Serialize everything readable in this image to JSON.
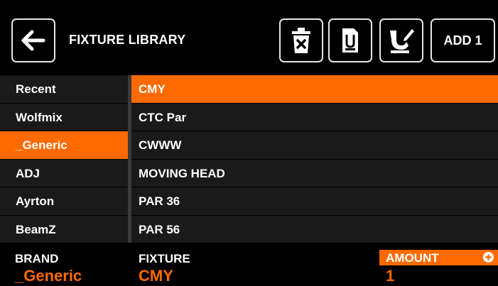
{
  "header": {
    "title": "FIXTURE LIBRARY",
    "add_label": "ADD 1",
    "icons": [
      "back-arrow-icon",
      "trash-icon",
      "save-icon",
      "edit-icon"
    ]
  },
  "brands": [
    {
      "label": "Recent"
    },
    {
      "label": "Wolfmix"
    },
    {
      "label": "_Generic"
    },
    {
      "label": "ADJ"
    },
    {
      "label": "Ayrton"
    },
    {
      "label": "BeamZ"
    }
  ],
  "fixtures": [
    {
      "label": "CMY"
    },
    {
      "label": "CTC Par"
    },
    {
      "label": "CWWW"
    },
    {
      "label": "MOVING HEAD"
    },
    {
      "label": "PAR 36"
    },
    {
      "label": "PAR 56"
    }
  ],
  "selected": {
    "brand_index": 2,
    "fixture_index": 0
  },
  "footer": {
    "brand_label": "BRAND",
    "brand_value": "_Generic",
    "fixture_label": "FIXTURE",
    "fixture_value": "CMY",
    "amount_label": "AMOUNT",
    "amount_value": "1"
  },
  "colors": {
    "accent": "#ff6a00",
    "row_bg": "#1a1a1a",
    "background": "#000000"
  }
}
